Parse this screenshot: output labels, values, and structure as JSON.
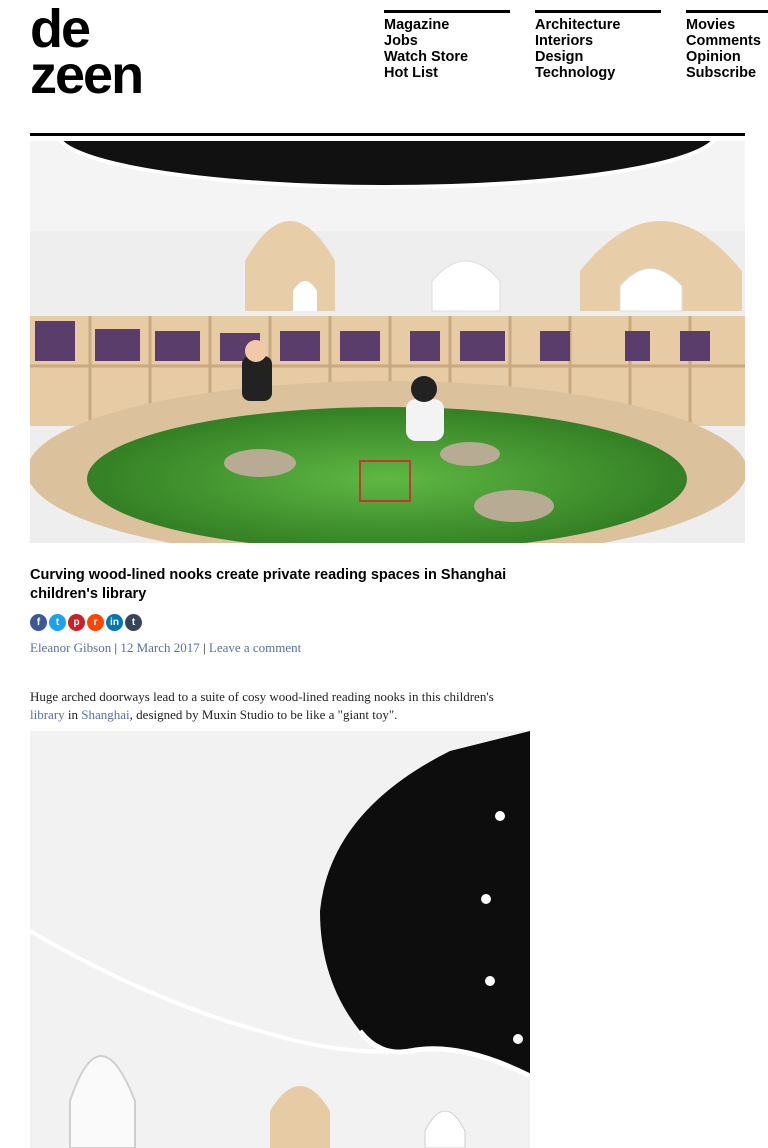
{
  "logo": {
    "line1": "de",
    "line2": "zeen"
  },
  "nav": {
    "col1": [
      "Magazine",
      "Jobs",
      "Watch Store",
      "Hot List"
    ],
    "col2": [
      "Architecture",
      "Interiors",
      "Design",
      "Technology"
    ],
    "col3": [
      "Movies",
      "Comments",
      "Opinion",
      "Subscribe"
    ]
  },
  "article": {
    "title": "Curving wood-lined nooks create private reading spaces in Shanghai children's library",
    "author": "Eleanor Gibson",
    "sep1": " | ",
    "date": "12 March 2017",
    "sep2": " | ",
    "comment_link": "Leave a comment",
    "intro_1": "Huge arched doorways lead to a suite of cosy wood-lined reading nooks in this children's ",
    "intro_link1": "library",
    "intro_2": " in ",
    "intro_link2": "Shanghai",
    "intro_3": ", designed by Muxin Studio to be like a \"giant toy\"."
  },
  "social": [
    {
      "icon": "facebook-icon",
      "glyph": "f",
      "color": "#3b5998"
    },
    {
      "icon": "twitter-icon",
      "glyph": "t",
      "color": "#1da1f2"
    },
    {
      "icon": "pinterest-icon",
      "glyph": "p",
      "color": "#cb2027"
    },
    {
      "icon": "reddit-icon",
      "glyph": "r",
      "color": "#ff4500"
    },
    {
      "icon": "linkedin-icon",
      "glyph": "in",
      "color": "#0077b5"
    },
    {
      "icon": "tumblr-icon",
      "glyph": "t",
      "color": "#35465c"
    }
  ],
  "colors": {
    "link": "#5570a8",
    "grass": "#4a9a32",
    "wood": "#e6cba4"
  }
}
